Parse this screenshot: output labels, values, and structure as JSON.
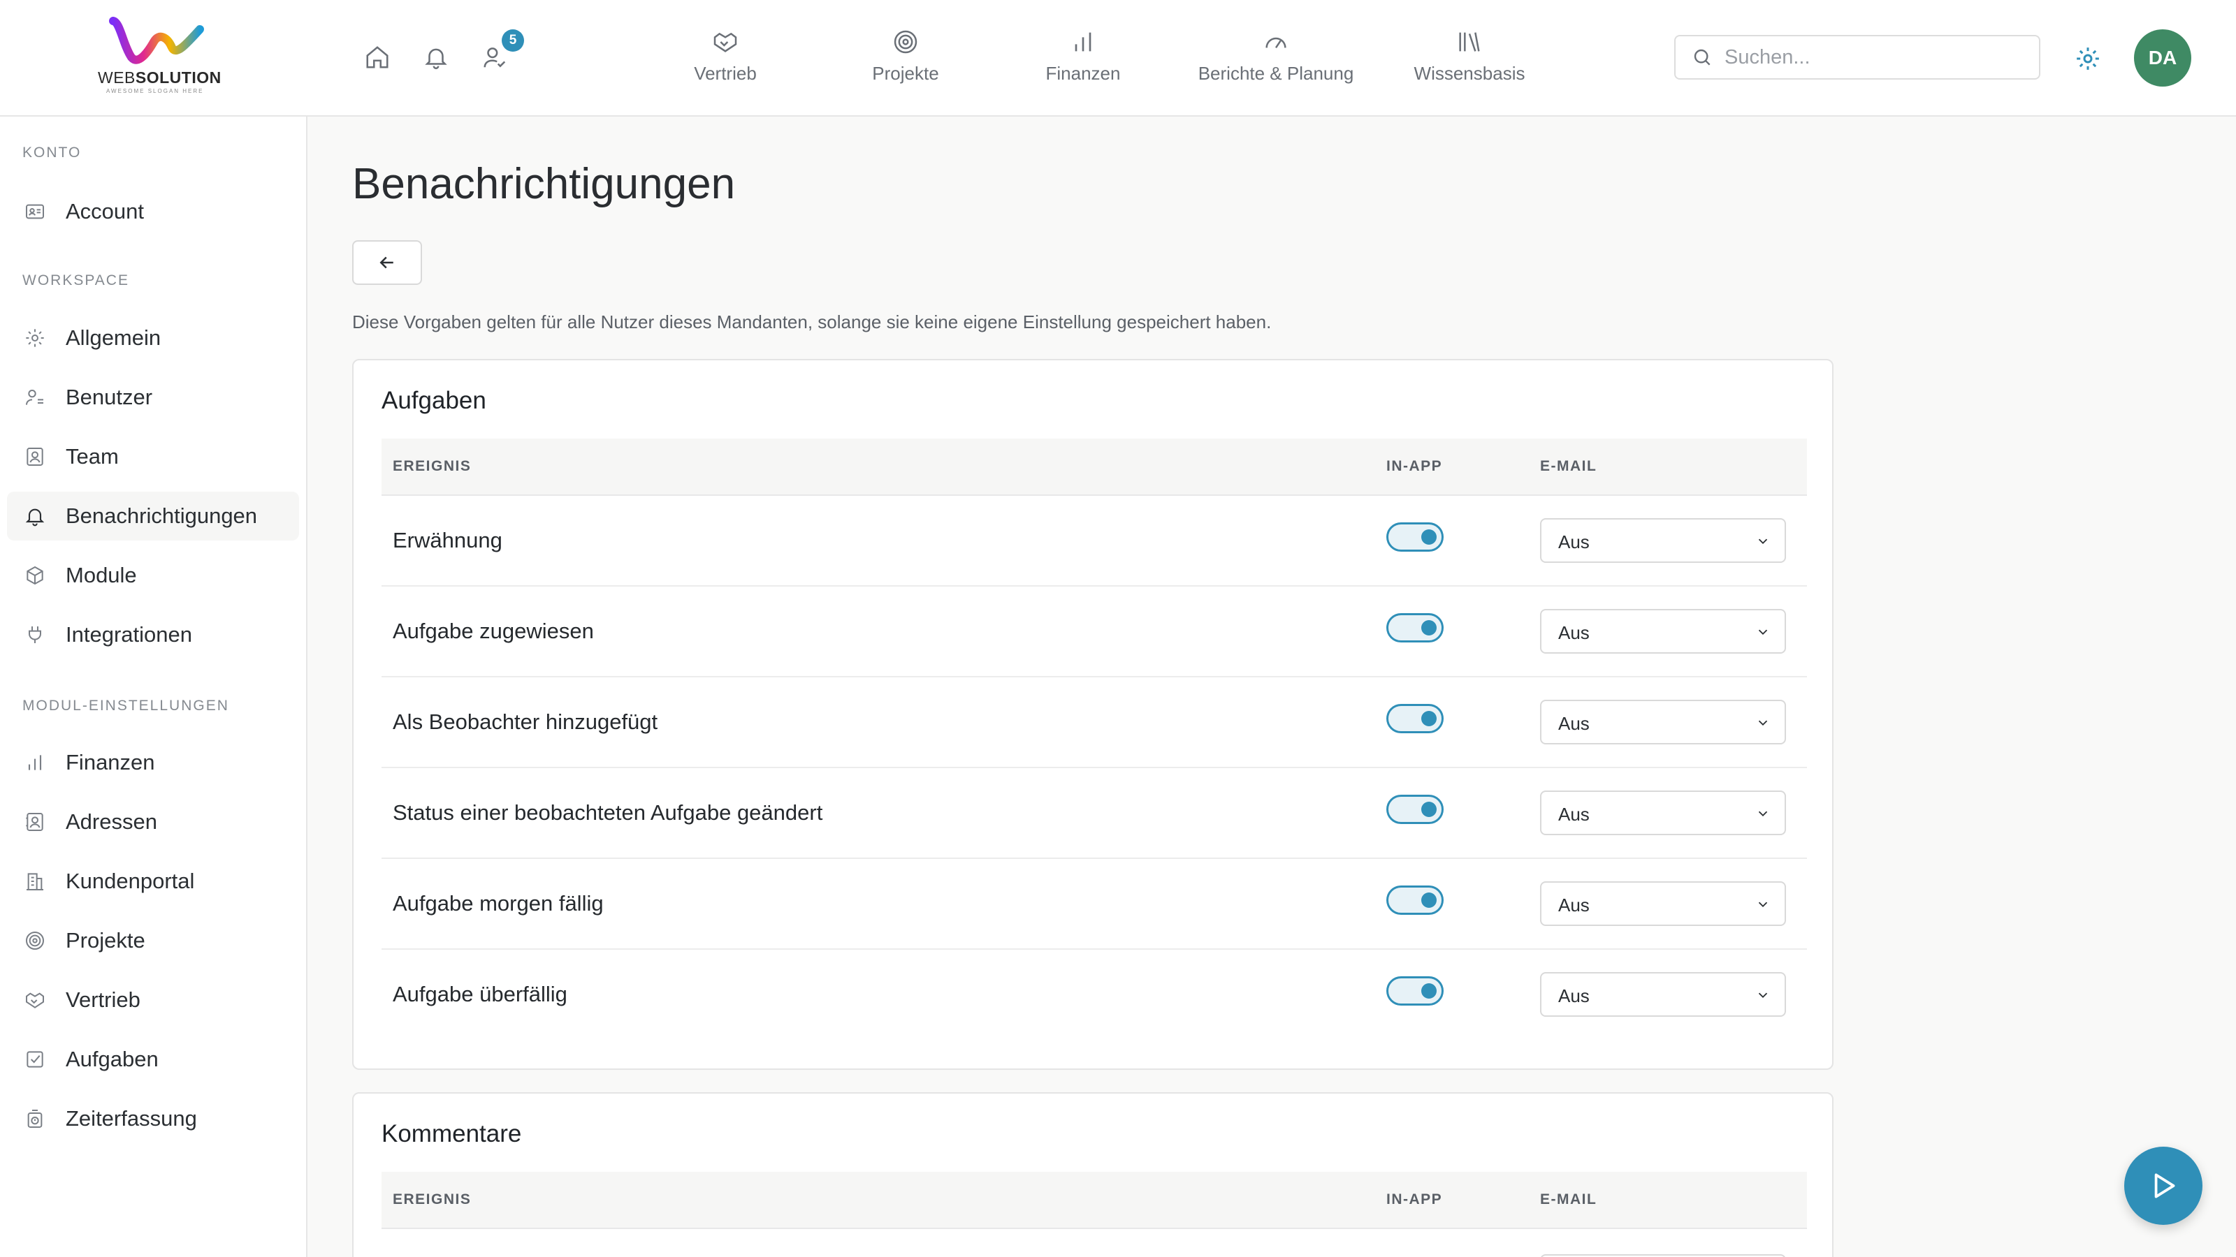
{
  "brand": {
    "logo_prefix": "WEB",
    "logo_bold": "SOLUTION",
    "slogan": "AWESOME SLOGAN HERE"
  },
  "header": {
    "quick_icons": [
      "home-icon",
      "bell-icon",
      "user-check-icon"
    ],
    "badge_count": "5",
    "nav": [
      {
        "label": "Vertrieb",
        "icon": "handshake-icon"
      },
      {
        "label": "Projekte",
        "icon": "target-icon"
      },
      {
        "label": "Finanzen",
        "icon": "bar-chart-icon"
      },
      {
        "label": "Berichte & Planung",
        "icon": "gauge-icon"
      },
      {
        "label": "Wissensbasis",
        "icon": "library-icon"
      }
    ],
    "search_placeholder": "Suchen...",
    "avatar_initials": "DA",
    "colors": {
      "accent": "#2f8fb8",
      "avatar": "#3f8a64"
    }
  },
  "sidebar": {
    "sections": [
      {
        "title": "KONTO",
        "items": [
          {
            "label": "Account",
            "icon": "id-card-icon"
          }
        ]
      },
      {
        "title": "WORKSPACE",
        "items": [
          {
            "label": "Allgemein",
            "icon": "gear-icon"
          },
          {
            "label": "Benutzer",
            "icon": "users-icon"
          },
          {
            "label": "Team",
            "icon": "contact-icon"
          },
          {
            "label": "Benachrichtigungen",
            "icon": "bell-icon",
            "active": true
          },
          {
            "label": "Module",
            "icon": "package-icon"
          },
          {
            "label": "Integrationen",
            "icon": "plug-icon"
          }
        ]
      },
      {
        "title": "MODUL-EINSTELLUNGEN",
        "items": [
          {
            "label": "Finanzen",
            "icon": "bar-chart-icon"
          },
          {
            "label": "Adressen",
            "icon": "contact-book-icon"
          },
          {
            "label": "Kundenportal",
            "icon": "building-icon"
          },
          {
            "label": "Projekte",
            "icon": "target-icon"
          },
          {
            "label": "Vertrieb",
            "icon": "handshake-icon"
          },
          {
            "label": "Aufgaben",
            "icon": "check-square-icon"
          },
          {
            "label": "Zeiterfassung",
            "icon": "timer-icon"
          }
        ]
      }
    ]
  },
  "main": {
    "title": "Benachrichtigungen",
    "intro": "Diese Vorgaben gelten für alle Nutzer dieses Mandanten, solange sie keine eigene Einstellung gespeichert haben.",
    "columns": {
      "event": "EREIGNIS",
      "in_app": "IN-APP",
      "email": "E-MAIL"
    },
    "cards": [
      {
        "title": "Aufgaben",
        "rows": [
          {
            "event": "Erwähnung",
            "in_app": true,
            "email": "Aus"
          },
          {
            "event": "Aufgabe zugewiesen",
            "in_app": true,
            "email": "Aus"
          },
          {
            "event": "Als Beobachter hinzugefügt",
            "in_app": true,
            "email": "Aus"
          },
          {
            "event": "Status einer beobachteten Aufgabe geändert",
            "in_app": true,
            "email": "Aus"
          },
          {
            "event": "Aufgabe morgen fällig",
            "in_app": true,
            "email": "Aus"
          },
          {
            "event": "Aufgabe überfällig",
            "in_app": true,
            "email": "Aus"
          }
        ]
      },
      {
        "title": "Kommentare",
        "rows": []
      }
    ]
  }
}
